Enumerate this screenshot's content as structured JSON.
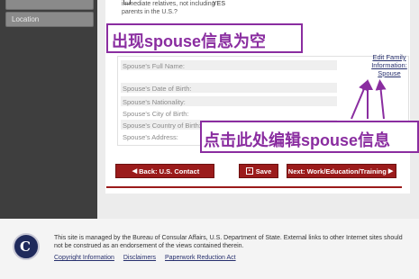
{
  "sidebar": {
    "tabs": [
      {
        "label": ""
      },
      {
        "label": "Location"
      }
    ]
  },
  "relatives": {
    "text": "immediate relatives, not including parents in the U.S.?",
    "yes_label": "YES"
  },
  "spouse": {
    "fields": [
      {
        "label": "Spouse's Full Name:"
      },
      {
        "label": "Spouse's Date of Birth:"
      },
      {
        "label": "Spouse's Nationality:"
      },
      {
        "label": "Spouse's City of Birth:"
      },
      {
        "label": "Spouse's Country of Birth:"
      },
      {
        "label": "Spouse's Address:"
      }
    ],
    "edit_link_lines": [
      "Edit Family",
      "Information:",
      "Spouse"
    ]
  },
  "annotations": {
    "top": "出现spouse信息为空",
    "bottom": "点击此处编辑spouse信息",
    "color": "#8a2da0"
  },
  "buttons": {
    "back": "Back: U.S. Contact",
    "save": "Save",
    "next": "Next: Work/Education/Training"
  },
  "footer": {
    "text": "This site is managed by the Bureau of Consular Affairs, U.S. Department of State. External links to other Internet sites should not be construed as an endorsement of the views contained therein.",
    "seal_letter": "C",
    "links": [
      "Copyright Information",
      "Disclaimers",
      "Paperwork Reduction Act"
    ]
  },
  "colors": {
    "button_red": "#9b1b1b",
    "link_blue": "#27306e",
    "sidebar_dark": "#3e3e3e"
  }
}
